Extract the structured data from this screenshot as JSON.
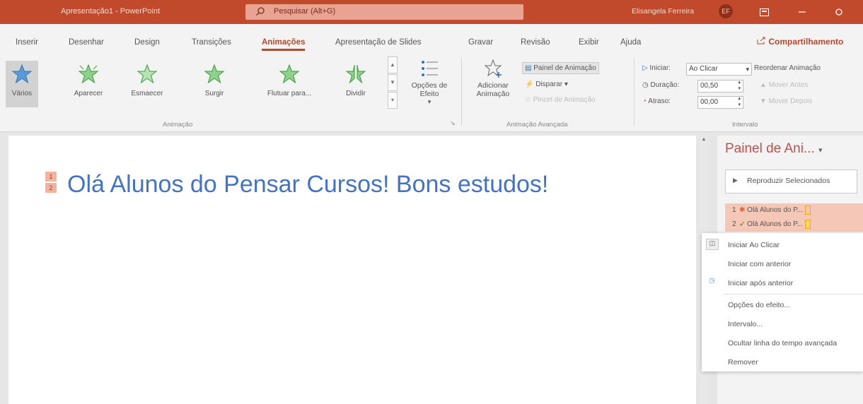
{
  "titlebar": {
    "title": "Apresentação1 - PowerPoint",
    "search_placeholder": "Pesquisar (Alt+G)",
    "user_name": "Elisangela Ferreira",
    "user_initials": "EF",
    "colors": {
      "bar": "#c04a2b",
      "accent": "#b7472a"
    }
  },
  "tabs": [
    "Inserir",
    "Desenhar",
    "Design",
    "Transições",
    "Animações",
    "Apresentação de Slides",
    "Gravar",
    "Revisão",
    "Exibir",
    "Ajuda"
  ],
  "active_tab": "Animações",
  "share_label": "Compartilhamento",
  "ribbon": {
    "gallery": [
      {
        "label": "Vários",
        "icon": "multi-star-icon"
      },
      {
        "label": "Aparecer",
        "icon": "star-burst-icon"
      },
      {
        "label": "Esmaecer",
        "icon": "star-fade-icon"
      },
      {
        "label": "Surgir",
        "icon": "star-rise-icon"
      },
      {
        "label": "Flutuar para...",
        "icon": "star-float-icon"
      },
      {
        "label": "Dividir",
        "icon": "star-split-icon"
      }
    ],
    "effect_options": "Opções de Efeito",
    "animation_group": "Animação",
    "add_animation": "Adicionar Animação",
    "animation_pane": "Painel de Animação",
    "trigger": "Disparar",
    "animation_painter": "Pincel de Animação",
    "advanced_group": "Animação Avançada",
    "start_label": "Iniciar:",
    "start_value": "Ao Clicar",
    "duration_label": "Duração:",
    "duration_value": "00,50",
    "delay_label": "Atraso:",
    "delay_value": "00,00",
    "timing_group": "Intervalo",
    "reorder_label": "Reordenar Animação",
    "move_earlier": "Mover Antes",
    "move_later": "Mover Depois"
  },
  "slide": {
    "title": "Olá Alunos do Pensar Cursos! Bons estudos!",
    "markers": [
      "1",
      "2"
    ]
  },
  "pane": {
    "title": "Painel de Ani...",
    "play_button": "Reproduzir Selecionados",
    "items": [
      {
        "number": "1",
        "label": "Olá Alunos do P..."
      },
      {
        "number": "2",
        "label": "Olá Alunos do P..."
      }
    ]
  },
  "context_menu": [
    "Iniciar Ao Clicar",
    "Iniciar com anterior",
    "Iniciar após anterior",
    "Opções do efeito...",
    "Intervalo...",
    "Ocultar linha do tempo avançada",
    "Remover"
  ]
}
